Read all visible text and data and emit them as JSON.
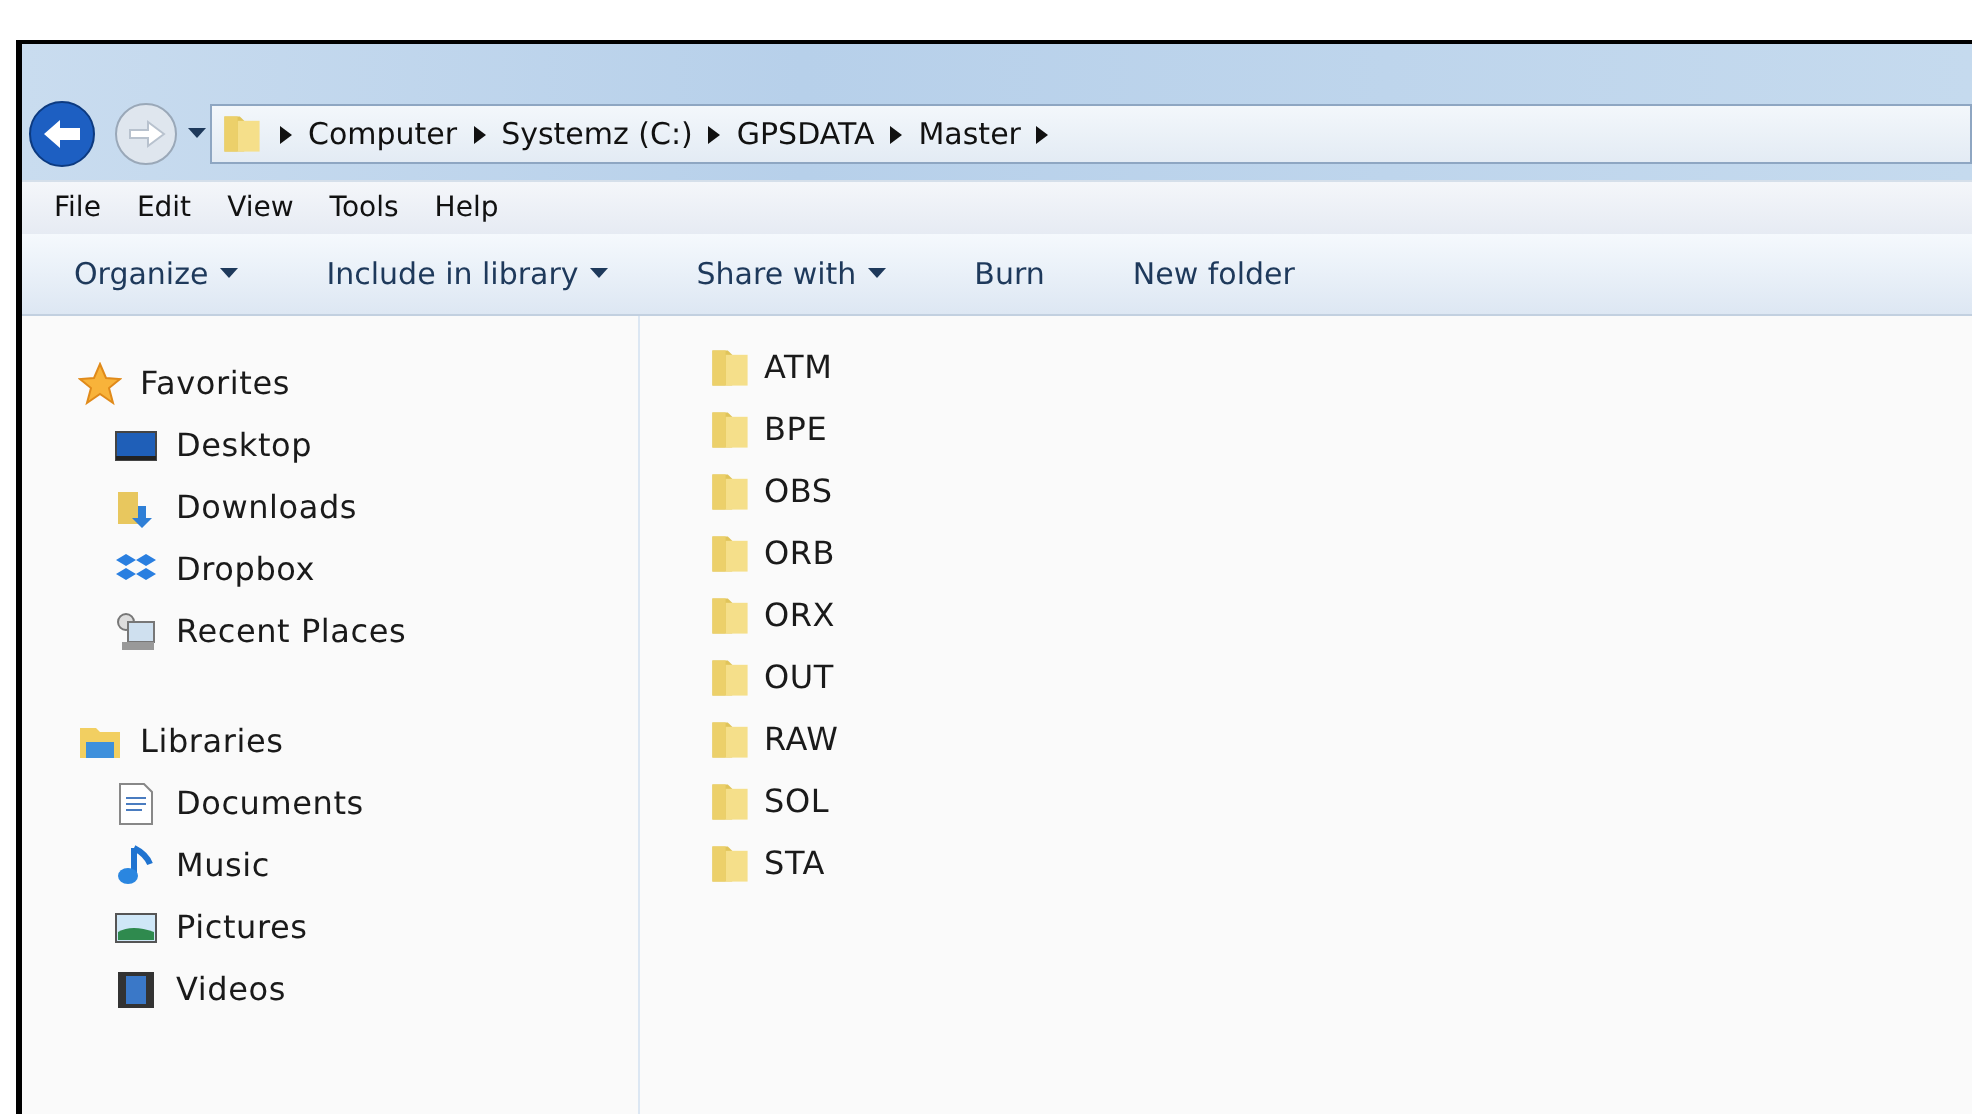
{
  "address_bar": {
    "segments": [
      "Computer",
      "Systemz (C:)",
      "GPSDATA",
      "Master"
    ]
  },
  "menu_bar": [
    "File",
    "Edit",
    "View",
    "Tools",
    "Help"
  ],
  "toolbar": [
    {
      "label": "Organize",
      "dropdown": true
    },
    {
      "label": "Include in library",
      "dropdown": true
    },
    {
      "label": "Share with",
      "dropdown": true
    },
    {
      "label": "Burn",
      "dropdown": false
    },
    {
      "label": "New folder",
      "dropdown": false
    }
  ],
  "sidebar": {
    "groups": [
      {
        "label": "Favorites",
        "kind": "star",
        "children": [
          {
            "label": "Desktop",
            "kind": "desktop"
          },
          {
            "label": "Downloads",
            "kind": "downloads"
          },
          {
            "label": "Dropbox",
            "kind": "dropbox"
          },
          {
            "label": "Recent Places",
            "kind": "recent"
          }
        ]
      },
      {
        "label": "Libraries",
        "kind": "library",
        "children": [
          {
            "label": "Documents",
            "kind": "documents"
          },
          {
            "label": "Music",
            "kind": "music"
          },
          {
            "label": "Pictures",
            "kind": "pictures"
          },
          {
            "label": "Videos",
            "kind": "videos"
          }
        ]
      }
    ]
  },
  "files": [
    "ATM",
    "BPE",
    "OBS",
    "ORB",
    "ORX",
    "OUT",
    "RAW",
    "SOL",
    "STA"
  ]
}
